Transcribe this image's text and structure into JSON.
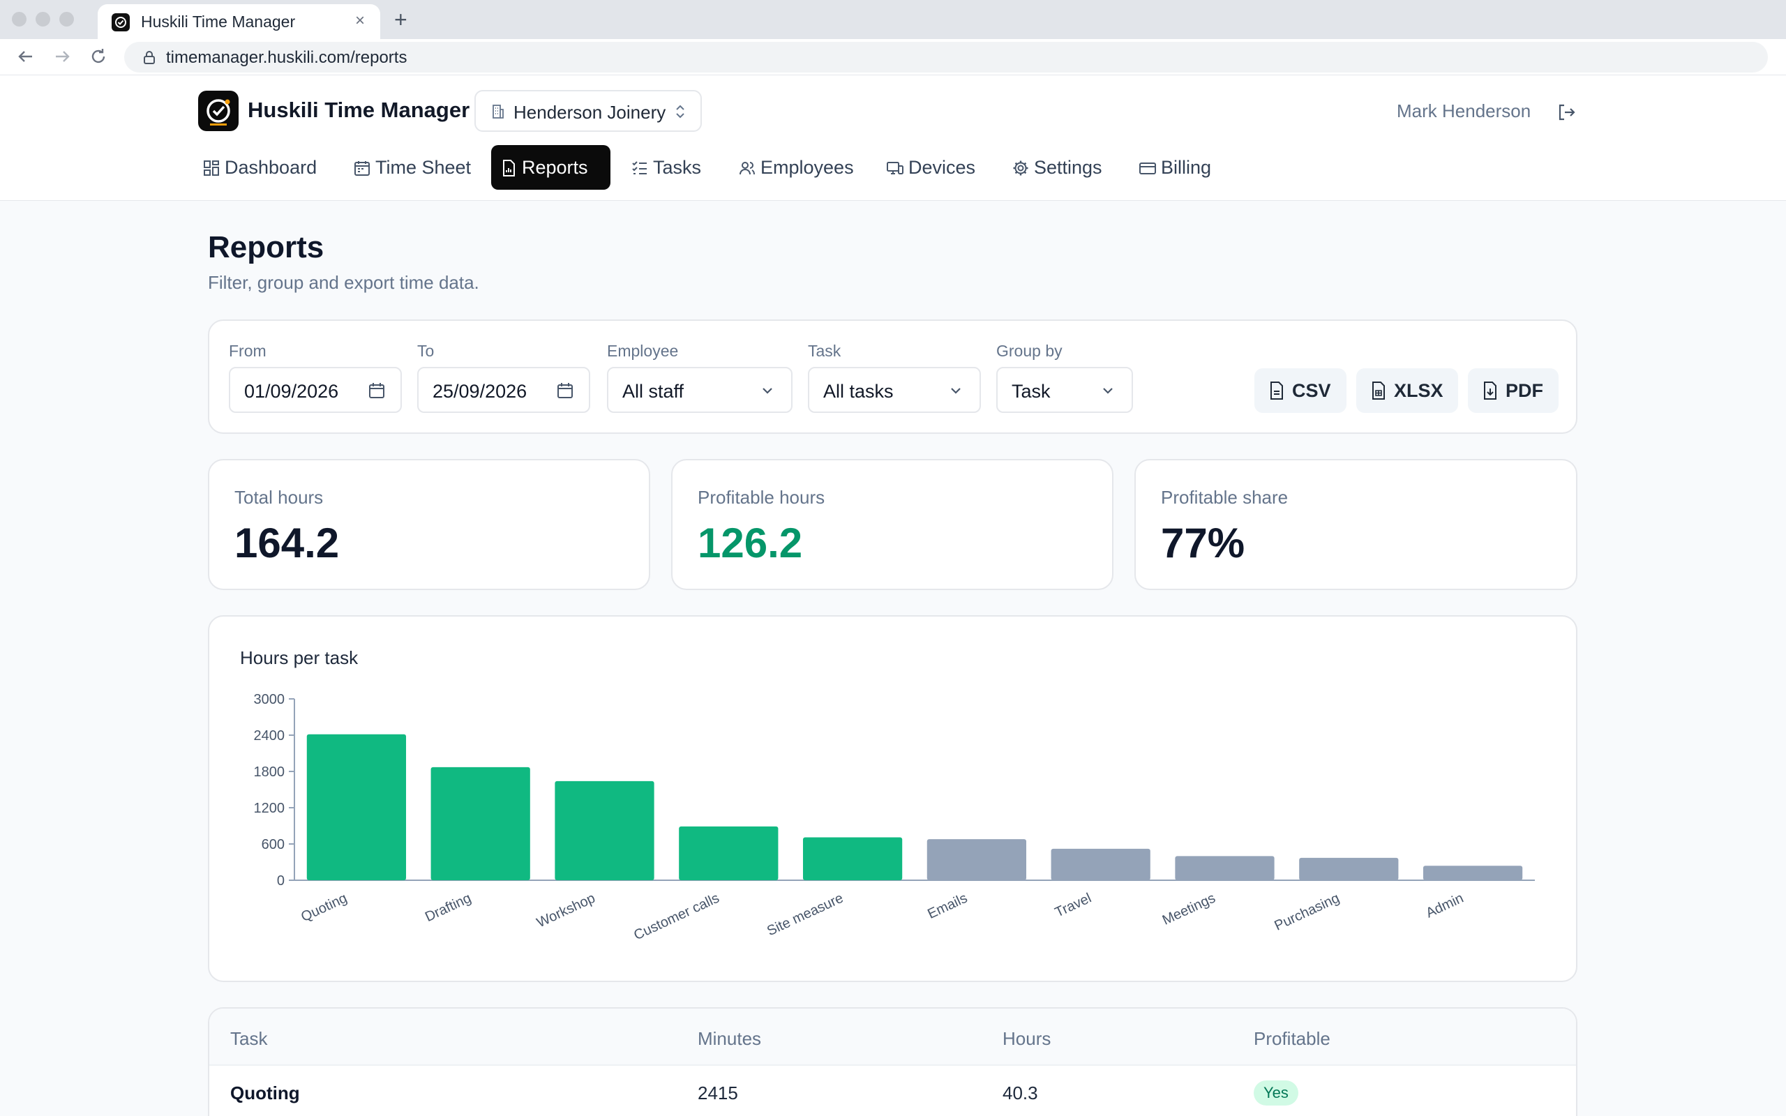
{
  "browser": {
    "tab_title": "Huskili Time Manager",
    "tab_close": "×",
    "new_tab": "+",
    "url": "timemanager.huskili.com/reports"
  },
  "header": {
    "brand": "Huskili Time Manager",
    "organization": "Henderson Joinery",
    "user_name": "Mark Henderson"
  },
  "nav": {
    "items": [
      {
        "label": "Dashboard",
        "icon": "dashboard-icon"
      },
      {
        "label": "Time Sheet",
        "icon": "calendar-icon"
      },
      {
        "label": "Reports",
        "icon": "report-icon",
        "active": true
      },
      {
        "label": "Tasks",
        "icon": "tasks-icon"
      },
      {
        "label": "Employees",
        "icon": "users-icon"
      },
      {
        "label": "Devices",
        "icon": "devices-icon"
      },
      {
        "label": "Settings",
        "icon": "gear-icon"
      },
      {
        "label": "Billing",
        "icon": "card-icon"
      }
    ]
  },
  "page": {
    "title": "Reports",
    "subtitle": "Filter, group and export time data."
  },
  "filters": {
    "from_label": "From",
    "from_value": "01/09/2026",
    "to_label": "To",
    "to_value": "25/09/2026",
    "employee_label": "Employee",
    "employee_value": "All staff",
    "task_label": "Task",
    "task_value": "All tasks",
    "group_label": "Group by",
    "group_value": "Task",
    "export": [
      "CSV",
      "XLSX",
      "PDF"
    ]
  },
  "stats": [
    {
      "label": "Total hours",
      "value": "164.2"
    },
    {
      "label": "Profitable hours",
      "value": "126.2"
    },
    {
      "label": "Profitable share",
      "value": "77%"
    }
  ],
  "chart_data": {
    "type": "bar",
    "title": "Hours per task",
    "categories": [
      "Quoting",
      "Drafting",
      "Workshop",
      "Customer calls",
      "Site measure",
      "Emails",
      "Travel",
      "Meetings",
      "Purchasing",
      "Admin"
    ],
    "values": [
      2415,
      1870,
      1640,
      890,
      710,
      680,
      520,
      400,
      370,
      240
    ],
    "profitable": [
      true,
      true,
      true,
      true,
      true,
      false,
      false,
      false,
      false,
      false
    ],
    "ylim": [
      0,
      3000
    ],
    "yticks": [
      0,
      600,
      1200,
      1800,
      2400,
      3000
    ],
    "colors": {
      "profitable": "#10b981",
      "non_profitable": "#94a3b8"
    },
    "grid": false,
    "xlabel": "",
    "ylabel": ""
  },
  "table": {
    "headers": [
      "Task",
      "Minutes",
      "Hours",
      "Profitable"
    ],
    "rows": [
      {
        "task": "Quoting",
        "minutes": "2415",
        "hours": "40.3",
        "profitable": "Yes"
      }
    ]
  }
}
